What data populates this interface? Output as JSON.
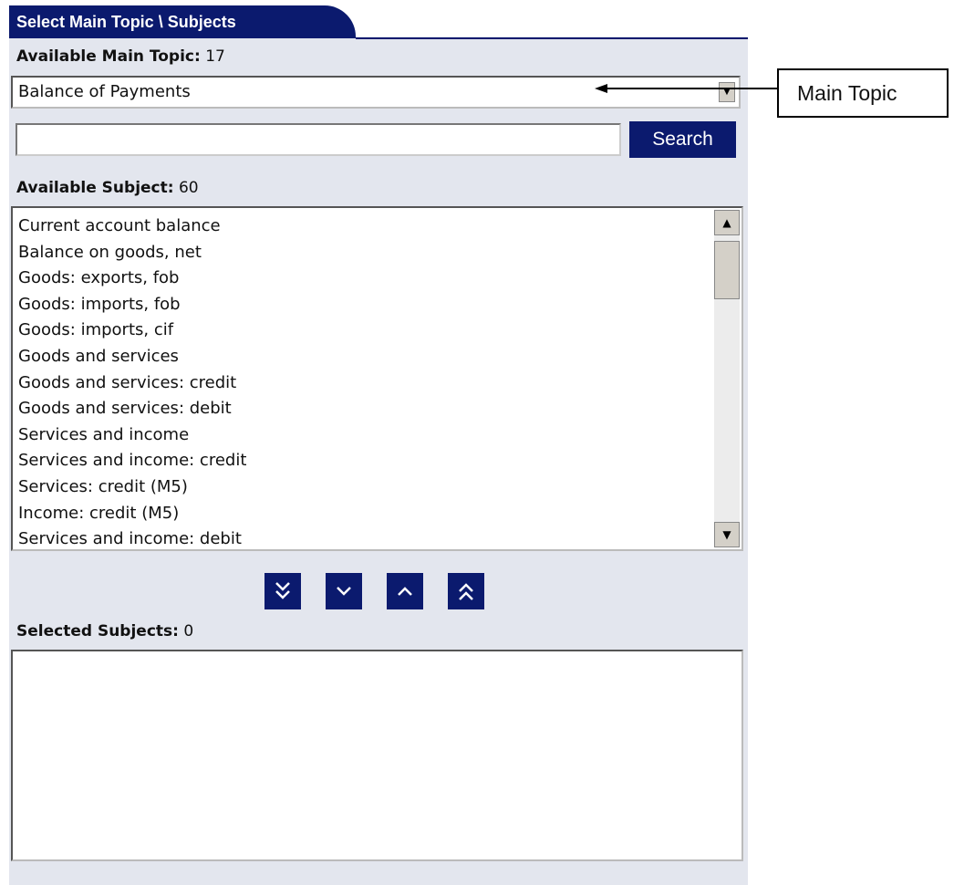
{
  "tab": {
    "title": "Select Main Topic \\ Subjects"
  },
  "main_topic": {
    "label": "Available Main Topic:",
    "count": "17",
    "selected": "Balance of Payments"
  },
  "search": {
    "value": "",
    "button_label": "Search"
  },
  "subjects": {
    "label": "Available Subject:",
    "count": "60",
    "items": [
      "Current account balance",
      "Balance on goods, net",
      "Goods: exports, fob",
      "Goods: imports, fob",
      "Goods: imports, cif",
      "Goods and services",
      "Goods and services: credit",
      "Goods and services: debit",
      "Services and income",
      "Services and income: credit",
      "Services: credit (M5)",
      "Income:  credit (M5)",
      "Services and income: debit"
    ]
  },
  "move_buttons": {
    "add_all": "»",
    "add_one": "⌄",
    "remove_one": "⌃",
    "remove_all": "«"
  },
  "selected": {
    "label": "Selected Subjects:",
    "count": "0"
  },
  "callout": {
    "text": "Main Topic"
  },
  "icons": {
    "dropdown": "chevron-down-icon",
    "scroll_up": "triangle-up-icon",
    "scroll_down": "triangle-down-icon"
  },
  "colors": {
    "accent": "#0b1a6e",
    "panel": "#e3e6ee"
  }
}
